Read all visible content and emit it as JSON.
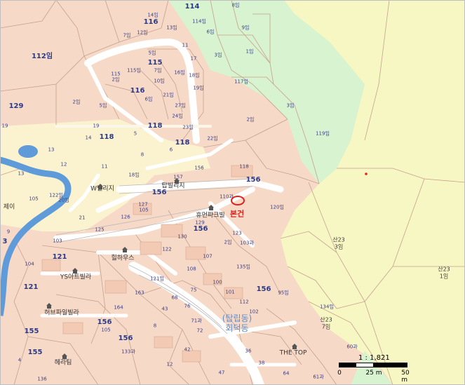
{
  "map": {
    "scale_text": "1 : 1,821",
    "scale_ticks": [
      "0",
      "25 m",
      "50 m"
    ],
    "subject_label": "본건",
    "district_name": "(탑립동)\n회덕동",
    "colors": {
      "residential": "#f6d9c7",
      "green_zone": "#d8f3cf",
      "yellow_zone": "#f7f7c4",
      "river": "#5f9bd8",
      "road": "#ffffff",
      "parcel_line": "#c7a08f",
      "subject_marker": "#e0231c"
    },
    "labels": [
      {
        "id": "l1",
        "text": "114",
        "style": "big"
      },
      {
        "id": "l2",
        "text": "8임",
        "style": "parcel"
      },
      {
        "id": "l3",
        "text": "14임",
        "style": "parcel"
      },
      {
        "id": "l4",
        "text": "116",
        "style": "big"
      },
      {
        "id": "l5",
        "text": "114임",
        "style": "parcel"
      },
      {
        "id": "l6",
        "text": "9임",
        "style": "parcel"
      },
      {
        "id": "l7",
        "text": "7임",
        "style": "parcel"
      },
      {
        "id": "l8",
        "text": "12임",
        "style": "parcel"
      },
      {
        "id": "l9",
        "text": "13임",
        "style": "parcel"
      },
      {
        "id": "l10",
        "text": "6임",
        "style": "parcel"
      },
      {
        "id": "l11",
        "text": "11",
        "style": "parcel"
      },
      {
        "id": "l12",
        "text": "112임",
        "style": "big"
      },
      {
        "id": "l13",
        "text": "5임",
        "style": "parcel"
      },
      {
        "id": "l14",
        "text": "115",
        "style": "big"
      },
      {
        "id": "l15",
        "text": "115임",
        "style": "parcel"
      },
      {
        "id": "l16",
        "text": "17",
        "style": "parcel"
      },
      {
        "id": "l17",
        "text": "3임",
        "style": "parcel"
      },
      {
        "id": "l18",
        "text": "1임",
        "style": "parcel"
      },
      {
        "id": "l19",
        "text": "115\n2임",
        "style": "parcel"
      },
      {
        "id": "l20",
        "text": "7임",
        "style": "parcel"
      },
      {
        "id": "l21",
        "text": "16임",
        "style": "parcel"
      },
      {
        "id": "l22",
        "text": "18임",
        "style": "parcel"
      },
      {
        "id": "l23",
        "text": "10임",
        "style": "parcel"
      },
      {
        "id": "l24",
        "text": "116",
        "style": "big"
      },
      {
        "id": "l25",
        "text": "19임",
        "style": "parcel"
      },
      {
        "id": "l26",
        "text": "117임",
        "style": "parcel"
      },
      {
        "id": "l27",
        "text": "21임",
        "style": "parcel"
      },
      {
        "id": "l28",
        "text": "6임",
        "style": "parcel"
      },
      {
        "id": "l29",
        "text": "129",
        "style": "big"
      },
      {
        "id": "l30",
        "text": "2임",
        "style": "parcel"
      },
      {
        "id": "l31",
        "text": "5임",
        "style": "parcel"
      },
      {
        "id": "l32",
        "text": "27임",
        "style": "parcel"
      },
      {
        "id": "l33",
        "text": "3임",
        "style": "parcel"
      },
      {
        "id": "l34",
        "text": "24임",
        "style": "parcel"
      },
      {
        "id": "l35",
        "text": "2임",
        "style": "parcel"
      },
      {
        "id": "l36",
        "text": "23임",
        "style": "parcel"
      },
      {
        "id": "l37",
        "text": "118",
        "style": "big"
      },
      {
        "id": "l38",
        "text": "119임",
        "style": "parcel"
      },
      {
        "id": "l39",
        "text": "14",
        "style": "parcel"
      },
      {
        "id": "l40",
        "text": "118",
        "style": "big"
      },
      {
        "id": "l41",
        "text": "5",
        "style": "parcel"
      },
      {
        "id": "l42",
        "text": "118",
        "style": "big"
      },
      {
        "id": "l43",
        "text": "22임",
        "style": "parcel"
      },
      {
        "id": "l44",
        "text": "19",
        "style": "parcel"
      },
      {
        "id": "l45",
        "text": "13",
        "style": "parcel"
      },
      {
        "id": "l46",
        "text": "6",
        "style": "parcel"
      },
      {
        "id": "l47",
        "text": "8",
        "style": "parcel"
      },
      {
        "id": "l48",
        "text": "11",
        "style": "parcel"
      },
      {
        "id": "l49",
        "text": "12",
        "style": "parcel"
      },
      {
        "id": "l50",
        "text": "13",
        "style": "parcel"
      },
      {
        "id": "l51",
        "text": "156",
        "style": "parcel"
      },
      {
        "id": "l52",
        "text": "118",
        "style": "parcel"
      },
      {
        "id": "l53",
        "text": "18임",
        "style": "parcel"
      },
      {
        "id": "l54",
        "text": "157",
        "style": "parcel"
      },
      {
        "id": "l55",
        "text": "탑빌리지",
        "style": "bldg"
      },
      {
        "id": "l56",
        "text": "156",
        "style": "big"
      },
      {
        "id": "l57",
        "text": "156",
        "style": "big"
      },
      {
        "id": "l58",
        "text": "W빌리지",
        "style": "bldg"
      },
      {
        "id": "l59",
        "text": "122임",
        "style": "parcel"
      },
      {
        "id": "l60",
        "text": "20임",
        "style": "parcel"
      },
      {
        "id": "l61",
        "text": "105",
        "style": "parcel"
      },
      {
        "id": "l62",
        "text": "127",
        "style": "parcel"
      },
      {
        "id": "l63",
        "text": "105",
        "style": "parcel"
      },
      {
        "id": "l64",
        "text": "110과",
        "style": "parcel"
      },
      {
        "id": "l65",
        "text": "120임",
        "style": "parcel"
      },
      {
        "id": "l66",
        "text": "본건",
        "style": "bonkeon"
      },
      {
        "id": "l67",
        "text": "휴먼파크빌",
        "style": "bldg"
      },
      {
        "id": "l68",
        "text": "126",
        "style": "parcel"
      },
      {
        "id": "l69",
        "text": "129",
        "style": "parcel"
      },
      {
        "id": "l70",
        "text": "21",
        "style": "parcel"
      },
      {
        "id": "l71",
        "text": "125",
        "style": "parcel"
      },
      {
        "id": "l72",
        "text": "156",
        "style": "big"
      },
      {
        "id": "l73",
        "text": "130",
        "style": "parcel"
      },
      {
        "id": "l74",
        "text": "123",
        "style": "parcel"
      },
      {
        "id": "l75",
        "text": "2임",
        "style": "parcel"
      },
      {
        "id": "l76",
        "text": "103과",
        "style": "parcel"
      },
      {
        "id": "l77",
        "text": "산23\n3임",
        "style": "sub"
      },
      {
        "id": "l78",
        "text": "103",
        "style": "parcel"
      },
      {
        "id": "l79",
        "text": "121",
        "style": "big"
      },
      {
        "id": "l80",
        "text": "122",
        "style": "parcel"
      },
      {
        "id": "l81",
        "text": "107",
        "style": "parcel"
      },
      {
        "id": "l82",
        "text": "힐하우스",
        "style": "bldg"
      },
      {
        "id": "l83",
        "text": "104",
        "style": "parcel"
      },
      {
        "id": "l84",
        "text": "108",
        "style": "parcel"
      },
      {
        "id": "l85",
        "text": "135임",
        "style": "parcel"
      },
      {
        "id": "l86",
        "text": "YS아트빌라",
        "style": "bldg"
      },
      {
        "id": "l87",
        "text": "121임",
        "style": "parcel"
      },
      {
        "id": "l88",
        "text": "100",
        "style": "parcel"
      },
      {
        "id": "l89",
        "text": "산23\n1임",
        "style": "sub"
      },
      {
        "id": "l90",
        "text": "121",
        "style": "big"
      },
      {
        "id": "l91",
        "text": "163",
        "style": "parcel"
      },
      {
        "id": "l92",
        "text": "101",
        "style": "parcel"
      },
      {
        "id": "l93",
        "text": "156",
        "style": "big"
      },
      {
        "id": "l94",
        "text": "75",
        "style": "parcel"
      },
      {
        "id": "l95",
        "text": "68",
        "style": "parcel"
      },
      {
        "id": "l96",
        "text": "112",
        "style": "parcel"
      },
      {
        "id": "l97",
        "text": "95임",
        "style": "parcel"
      },
      {
        "id": "l98",
        "text": "허브파일빌라",
        "style": "bldg"
      },
      {
        "id": "l99",
        "text": "164",
        "style": "parcel"
      },
      {
        "id": "l100",
        "text": "43",
        "style": "parcel"
      },
      {
        "id": "l101",
        "text": "76",
        "style": "parcel"
      },
      {
        "id": "l102",
        "text": "102",
        "style": "parcel"
      },
      {
        "id": "l103",
        "text": "134임",
        "style": "parcel"
      },
      {
        "id": "l104",
        "text": "156",
        "style": "big"
      },
      {
        "id": "l105",
        "text": "105",
        "style": "parcel"
      },
      {
        "id": "l106",
        "text": "71과",
        "style": "parcel"
      },
      {
        "id": "l107",
        "text": "산23\n7임",
        "style": "sub"
      },
      {
        "id": "l108",
        "text": "155",
        "style": "big"
      },
      {
        "id": "l109",
        "text": "8",
        "style": "parcel"
      },
      {
        "id": "l110",
        "text": "156",
        "style": "big"
      },
      {
        "id": "l111",
        "text": "72",
        "style": "parcel"
      },
      {
        "id": "l112",
        "text": "155",
        "style": "big"
      },
      {
        "id": "l113",
        "text": "133과",
        "style": "parcel"
      },
      {
        "id": "l114",
        "text": "42",
        "style": "parcel"
      },
      {
        "id": "l115",
        "text": "36",
        "style": "parcel"
      },
      {
        "id": "l116",
        "text": "THE TOP",
        "style": "bldg"
      },
      {
        "id": "l117",
        "text": "60과",
        "style": "parcel"
      },
      {
        "id": "l118",
        "text": "헤라팀",
        "style": "bldg"
      },
      {
        "id": "l119",
        "text": "12",
        "style": "parcel"
      },
      {
        "id": "l120",
        "text": "47",
        "style": "parcel"
      },
      {
        "id": "l121",
        "text": "38",
        "style": "parcel"
      },
      {
        "id": "l122",
        "text": "64",
        "style": "parcel"
      },
      {
        "id": "l123",
        "text": "61과",
        "style": "parcel"
      },
      {
        "id": "l124",
        "text": "136",
        "style": "parcel"
      },
      {
        "id": "l125",
        "text": "제이",
        "style": "bldg"
      },
      {
        "id": "l126",
        "text": "3",
        "style": "big"
      },
      {
        "id": "l127",
        "text": "4",
        "style": "parcel"
      },
      {
        "id": "l128",
        "text": "9",
        "style": "parcel"
      },
      {
        "id": "l129",
        "text": "19",
        "style": "parcel"
      }
    ]
  }
}
